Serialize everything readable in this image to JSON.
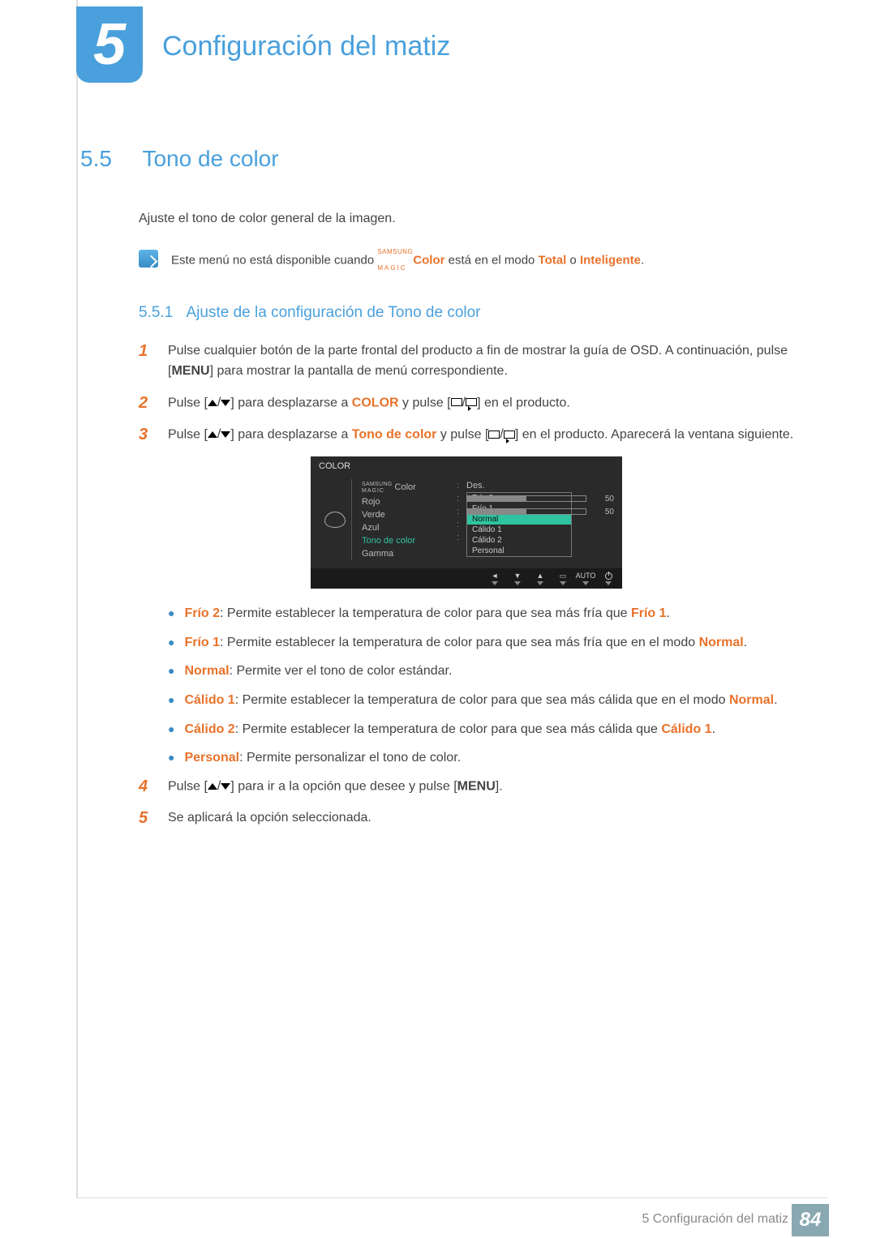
{
  "chapter": {
    "number": "5",
    "title": "Configuración del matiz"
  },
  "section": {
    "number": "5.5",
    "title": "Tono de color",
    "intro": "Ajuste el tono de color general de la imagen."
  },
  "note": {
    "pre": "Este menú no está disponible cuando ",
    "magic_top": "SAMSUNG",
    "magic_bottom": "MAGIC",
    "magic_suffix": "Color",
    "mid": " está en el modo ",
    "opt1": "Total",
    "or": " o ",
    "opt2": "Inteligente",
    "end": "."
  },
  "subsection": {
    "number": "5.5.1",
    "title": "Ajuste de la configuración de Tono de color"
  },
  "steps": {
    "s1": {
      "n": "1",
      "a": "Pulse cualquier botón de la parte frontal del producto a fin de mostrar la guía de OSD. A continuación, pulse [",
      "menu": "MENU",
      "b": "] para mostrar la pantalla de menú correspondiente."
    },
    "s2": {
      "n": "2",
      "a": "Pulse [",
      "b": "] para desplazarse a ",
      "target": "COLOR",
      "c": " y pulse [",
      "d": "] en el producto."
    },
    "s3": {
      "n": "3",
      "a": "Pulse [",
      "b": "] para desplazarse a ",
      "target": "Tono de color",
      "c": " y pulse [",
      "d": "] en el producto. Aparecerá la ventana siguiente."
    },
    "s4": {
      "n": "4",
      "a": "Pulse [",
      "b": "] para ir a la opción que desee y pulse [",
      "menu": "MENU",
      "c": "]."
    },
    "s5": {
      "n": "5",
      "a": "Se aplicará la opción seleccionada."
    }
  },
  "osd": {
    "title": "COLOR",
    "magic_top": "SAMSUNG",
    "magic_bottom": "MAGIC",
    "magic_label": " Color",
    "items": {
      "rojo": "Rojo",
      "verde": "Verde",
      "azul": "Azul",
      "tono": "Tono de color",
      "gamma": "Gamma"
    },
    "values": {
      "des": "Des.",
      "rojo": "50",
      "verde": "50"
    },
    "dropdown": {
      "frio2": "Frío 2",
      "frio1": "Frío 1",
      "normal": "Normal",
      "calido1": "Cálido 1",
      "calido2": "Cálido 2",
      "personal": "Personal"
    },
    "nav": {
      "auto": "AUTO"
    }
  },
  "bullets": {
    "b1": {
      "name": "Frío 2",
      "text": ": Permite establecer la temperatura de color para que sea más fría que ",
      "ref": "Frío 1",
      "end": "."
    },
    "b2": {
      "name": "Frío 1",
      "text": ": Permite establecer la temperatura de color para que sea más fría que en el modo ",
      "ref": "Normal",
      "end": "."
    },
    "b3": {
      "name": "Normal",
      "text": ": Permite ver el tono de color estándar."
    },
    "b4": {
      "name": "Cálido 1",
      "text": ": Permite establecer la temperatura de color para que sea más cálida que en el modo ",
      "ref": "Normal",
      "end": "."
    },
    "b5": {
      "name": "Cálido 2",
      "text": ": Permite establecer la temperatura de color para que sea más cálida que ",
      "ref": "Cálido 1",
      "end": "."
    },
    "b6": {
      "name": "Personal",
      "text": ": Permite personalizar el tono de color."
    }
  },
  "footer": {
    "chnum": "5",
    "chtitle": "Configuración del matiz",
    "page": "84"
  }
}
